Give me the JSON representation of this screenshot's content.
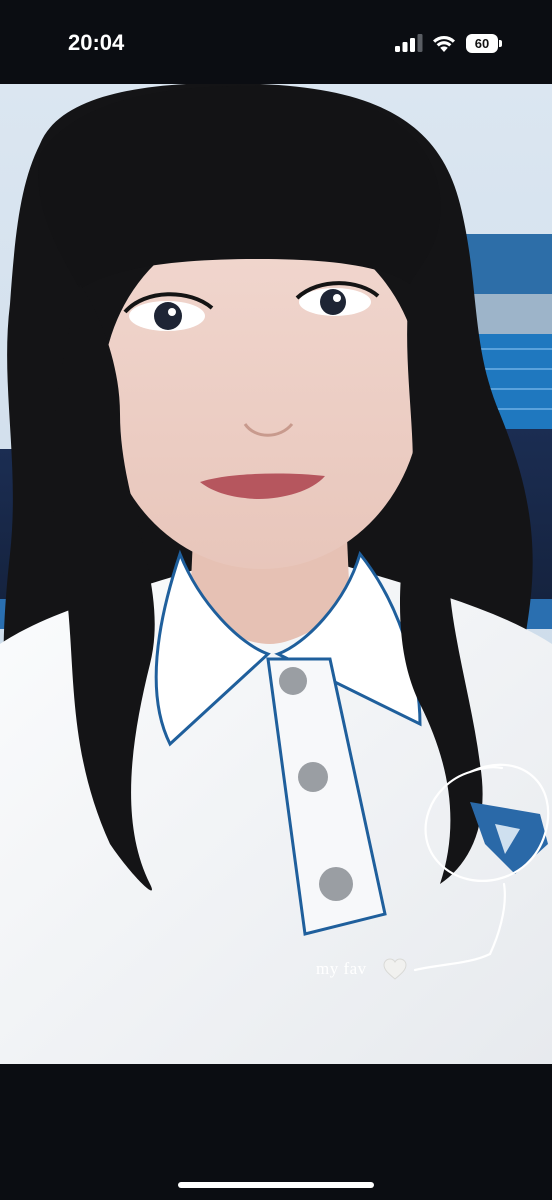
{
  "status_bar": {
    "time": "20:04",
    "battery_level": "60",
    "signal_bars": 3,
    "wifi": true
  },
  "photo": {
    "caption": "my fav",
    "caption_icon": "heart-icon",
    "annotation_icon": "circle-doodle-icon"
  },
  "colors": {
    "background": "#0b0d12",
    "shirt": "#f4f5f6",
    "shirt_trim": "#1f5f9c",
    "hair": "#121214",
    "seats": "#1d6fb3",
    "sky": "#cfe0ef"
  }
}
